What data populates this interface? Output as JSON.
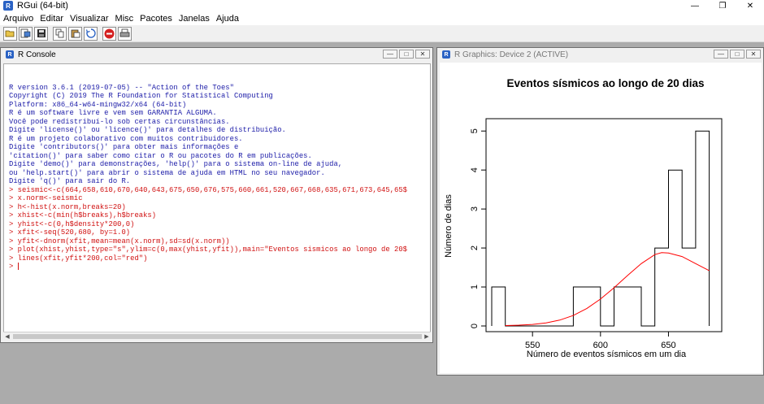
{
  "app": {
    "title": "RGui (64-bit)"
  },
  "menu": [
    "Arquivo",
    "Editar",
    "Visualizar",
    "Misc",
    "Pacotes",
    "Janelas",
    "Ajuda"
  ],
  "toolbar": [
    "open-script-icon",
    "load-workspace-icon",
    "save-workspace-icon",
    "copy-icon",
    "paste-icon",
    "copy-paste-icon",
    "stop-icon",
    "print-icon"
  ],
  "console": {
    "title": "R Console",
    "output": [
      "R version 3.6.1 (2019-07-05) -- \"Action of the Toes\"",
      "Copyright (C) 2019 The R Foundation for Statistical Computing",
      "Platform: x86_64-w64-mingw32/x64 (64-bit)",
      "",
      "R é um software livre e vem sem GARANTIA ALGUMA.",
      "Você pode redistribuí-lo sob certas circunstâncias.",
      "Digite 'license()' ou 'licence()' para detalhes de distribuição.",
      "",
      "R é um projeto colaborativo com muitos contribuidores.",
      "Digite 'contributors()' para obter mais informações e",
      "'citation()' para saber como citar o R ou pacotes do R em publicações.",
      "",
      "Digite 'demo()' para demonstrações, 'help()' para o sistema on-line de ajuda,",
      "ou 'help.start()' para abrir o sistema de ajuda em HTML no seu navegador.",
      "Digite 'q()' para sair do R.",
      ""
    ],
    "commands": [
      "> seismic<-c(664,658,610,670,640,643,675,650,676,575,660,661,520,667,668,635,671,673,645,65$",
      "> x.norm<-seismic",
      "> h<-hist(x.norm,breaks=20)",
      "> xhist<-c(min(h$breaks),h$breaks)",
      "> yhist<-c(0,h$density*200,0)",
      "> xfit<-seq(520,680, by=1.0)",
      "> yfit<-dnorm(xfit,mean=mean(x.norm),sd=sd(x.norm))",
      "> plot(xhist,yhist,type=\"s\",ylim=c(0,max(yhist,yfit)),main=\"Eventos sismicos ao longo de 20$",
      "> lines(xfit,yfit*200,col=\"red\")",
      "> "
    ]
  },
  "graphics": {
    "title": "R Graphics: Device 2 (ACTIVE)",
    "chart_data": {
      "type": "line",
      "title": "Eventos sísmicos ao longo de 20 dias",
      "xlabel": "Número de eventos sísmicos em um dia",
      "ylabel": "Número de dias",
      "xlim": [
        520,
        685
      ],
      "ylim": [
        0,
        5.15
      ],
      "xticks": [
        550,
        600,
        650
      ],
      "yticks": [
        0,
        1,
        2,
        3,
        4,
        5
      ],
      "series": [
        {
          "style": "step",
          "color": "#000000",
          "x": [
            520,
            520,
            530,
            570,
            580,
            600,
            610,
            630,
            640,
            650,
            660,
            670,
            680,
            680
          ],
          "y": [
            0,
            1,
            0,
            0,
            1,
            0,
            1,
            0,
            2,
            4,
            2,
            5,
            4,
            0
          ]
        },
        {
          "style": "line",
          "color": "#ff0000",
          "x": [
            530,
            540,
            550,
            560,
            570,
            580,
            590,
            600,
            610,
            620,
            630,
            640,
            645,
            650,
            660,
            670,
            680
          ],
          "y": [
            0.01,
            0.02,
            0.04,
            0.08,
            0.15,
            0.27,
            0.45,
            0.69,
            0.98,
            1.3,
            1.6,
            1.83,
            1.88,
            1.87,
            1.78,
            1.6,
            1.42
          ]
        }
      ]
    }
  }
}
